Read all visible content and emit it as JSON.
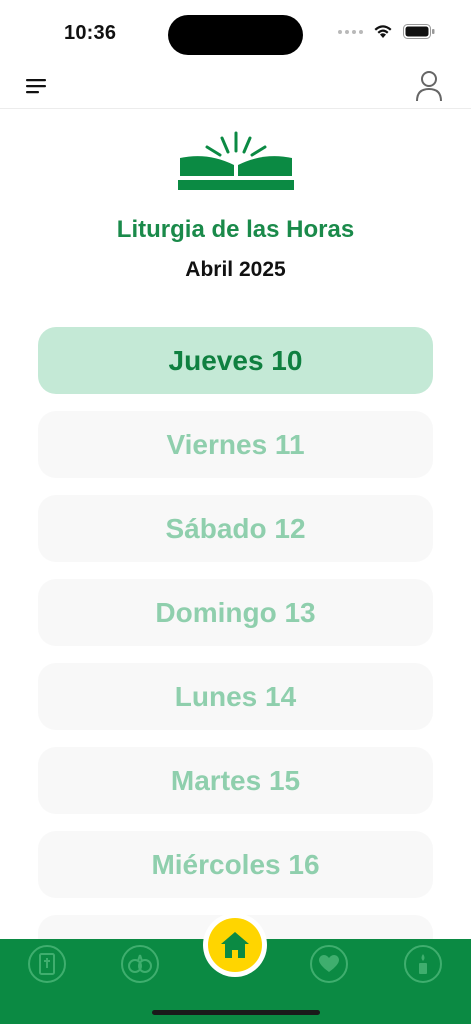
{
  "status": {
    "time": "10:36"
  },
  "header": {
    "title": "Liturgia de las Horas",
    "month": "Abril 2025"
  },
  "days": [
    {
      "label": "Jueves 10",
      "active": true
    },
    {
      "label": "Viernes 11",
      "active": false
    },
    {
      "label": "Sábado 12",
      "active": false
    },
    {
      "label": "Domingo 13",
      "active": false
    },
    {
      "label": "Lunes 14",
      "active": false
    },
    {
      "label": "Martes 15",
      "active": false
    },
    {
      "label": "Miércoles 16",
      "active": false
    },
    {
      "label": "",
      "active": false
    }
  ],
  "nav": {
    "items": [
      "bible-icon",
      "hands-icon",
      "home-icon",
      "heart-icon",
      "candle-icon"
    ],
    "active": "home-icon"
  },
  "colors": {
    "brand": "#0b8a43",
    "accent_text": "#1a8a4a",
    "active_day_bg": "#c4e9d6",
    "inactive_day_text": "#8fcfad",
    "home_button": "#ffd500"
  }
}
